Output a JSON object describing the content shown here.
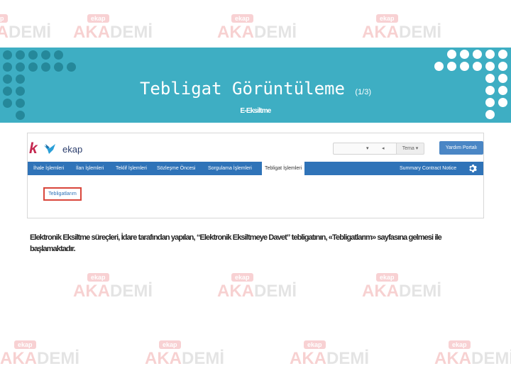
{
  "slide": {
    "title": "Tebligat Görüntüleme",
    "page_indicator": "(1/3)",
    "subtitle": "E-Eksiltme",
    "description": "Elektronik Eksiltme süreçleri, İdare tarafından yapılan, “Elektronik Eksiltmeye Davet” tebligatının, «Tebligatlarım» sayfasına gelmesi ile başlamaktadır."
  },
  "watermark": {
    "top_text": "ekap",
    "main_text_a": "AKA",
    "main_text_b": "DEMİ"
  },
  "app": {
    "logo": {
      "letter": "k",
      "text": "ekap"
    },
    "select_caret": "▾",
    "select_mark": "◂",
    "theme_label": "Tema ▾",
    "help_button": "Yardım Portalı",
    "nav": [
      "İhale İşlemleri",
      "İlan İşlemleri",
      "Teklif İşlemleri",
      "Sözleşme Öncesi",
      "Sorgulama İşlemleri",
      "Tebligat İşlemleri",
      "Summary Contract Notice"
    ],
    "active_tab": "Tebligatlarım"
  },
  "colors": {
    "header": "#3eaec3",
    "nav": "#2f73b8",
    "highlight": "#d9463b",
    "brand_red": "#c4274f"
  },
  "icons": {
    "settings": "gear-icon",
    "logo_bird": "bird-logo-icon"
  }
}
